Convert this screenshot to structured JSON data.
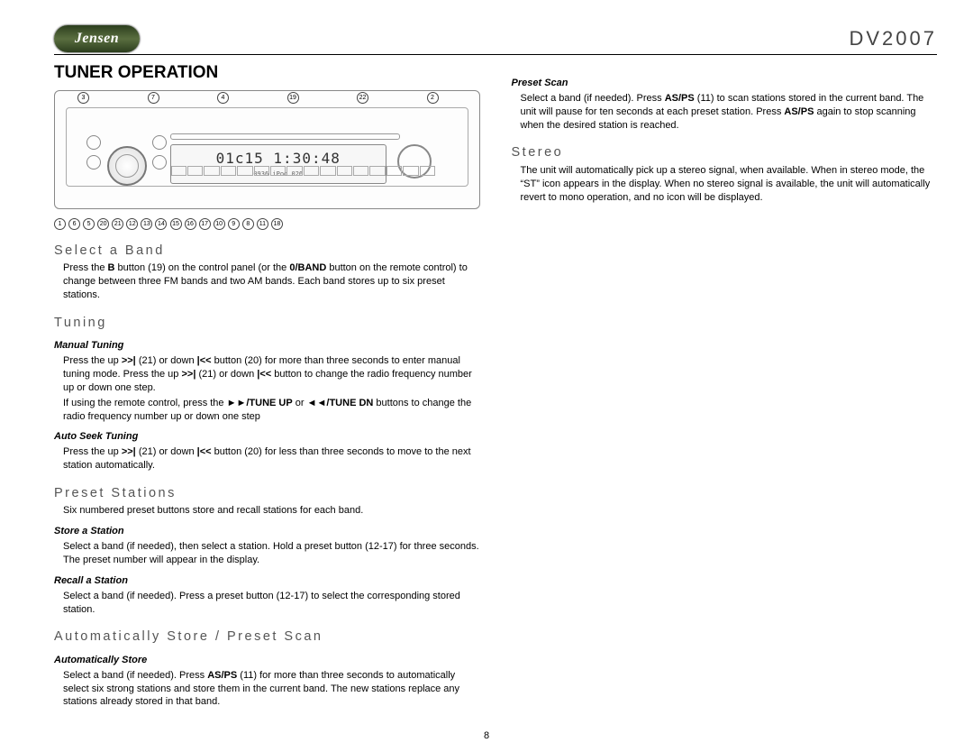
{
  "header": {
    "logo_text": "Jensen",
    "model": "DV2007"
  },
  "left": {
    "main_heading": "TUNER OPERATION",
    "diagram": {
      "lcd_main": "01c15 1:30:48",
      "lcd_sub": "0936  iPod  026",
      "callouts_top": [
        "3",
        "7",
        "4",
        "19",
        "22",
        "2"
      ],
      "callouts_bot": [
        "1",
        "6",
        "5",
        "20",
        "21",
        "12",
        "13",
        "14",
        "15",
        "16",
        "17",
        "10",
        "9",
        "8",
        "11",
        "18"
      ]
    },
    "sections": [
      {
        "heading": "Select a Band",
        "body": "Press the <b>B</b> button (19) on the control panel (or the <b>0/BAND</b> button on the remote control) to change between three FM bands and two AM bands. Each band stores up to six preset stations."
      },
      {
        "heading": "Tuning",
        "subs": [
          {
            "sub": "Manual Tuning",
            "body": "Press the up <b>&gt;&gt;|</b> (21) or down <b>|&lt;&lt;</b> button (20) for more than three seconds to enter manual tuning mode. Press the up <b>&gt;&gt;|</b> (21) or down <b>|&lt;&lt;</b> button to change the radio frequency number up or down one step.",
            "body2": "If using the remote control, press the <b>&#9658;&#9658;/TUNE UP</b> or <b>&#9668;&#9668;/TUNE DN</b> buttons to change the radio frequency number up or down one step"
          },
          {
            "sub": "Auto Seek Tuning",
            "body": "Press the up <b>&gt;&gt;|</b> (21) or down <b>|&lt;&lt;</b> button (20) for less than three seconds to move to the next station automatically."
          }
        ]
      },
      {
        "heading": "Preset Stations",
        "body": "Six numbered preset buttons store and recall stations for each band.",
        "subs": [
          {
            "sub": "Store a Station",
            "body": "Select a band (if needed), then select a station. Hold a preset button (12-17) for three seconds. The preset number will appear in the display."
          },
          {
            "sub": "Recall a Station",
            "body": "Select a band (if needed). Press a preset button (12-17) to select the corresponding stored station."
          }
        ]
      },
      {
        "heading": "Automatically Store / Preset Scan",
        "subs": [
          {
            "sub": "Automatically Store",
            "body": "Select a band (if needed). Press <b>AS/PS</b> (11) for more than three seconds to automatically select six strong stations and store them in the current band. The new stations replace any stations already stored in that band."
          }
        ]
      }
    ]
  },
  "right": {
    "sections": [
      {
        "sub": "Preset Scan",
        "body": "Select a band (if needed). Press <b>AS/PS</b> (11) to scan stations stored in the current band. The unit will pause for ten seconds at each preset station. Press <b>AS/PS</b> again to stop scanning when the desired station is reached."
      },
      {
        "heading": "Stereo",
        "body": "The unit will automatically pick up a stereo signal, when available. When in stereo mode, the “ST” icon appears in the display. When no stereo signal is available, the unit will automatically revert to mono operation, and no icon will be displayed."
      }
    ]
  },
  "page_number": "8"
}
